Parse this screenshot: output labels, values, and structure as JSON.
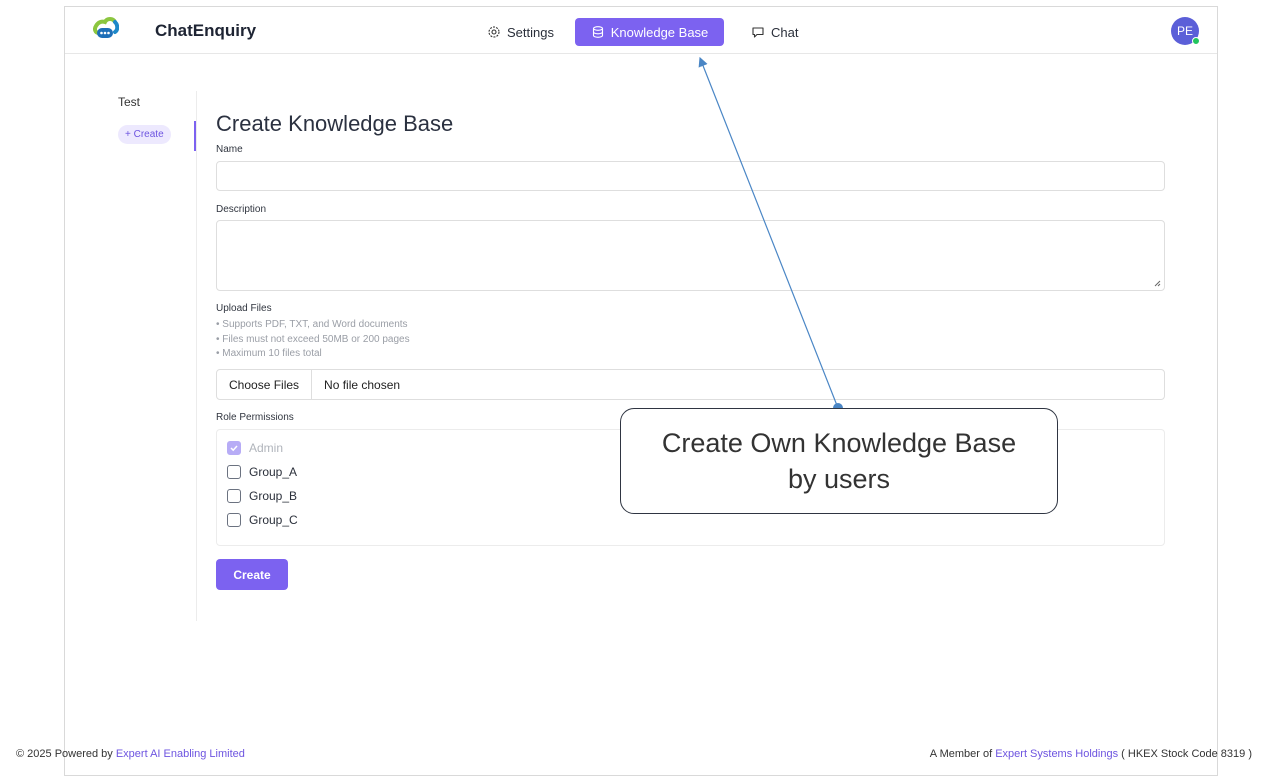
{
  "header": {
    "brand": "ChatEnquiry",
    "nav": [
      {
        "label": "Settings",
        "icon": "gear-icon"
      },
      {
        "label": "Knowledge Base",
        "icon": "database-icon",
        "active": true
      },
      {
        "label": "Chat",
        "icon": "chat-bubble-icon"
      }
    ],
    "avatar": "PE"
  },
  "sidebar": {
    "items": [
      {
        "label": "Test"
      }
    ],
    "create_label": "+ Create"
  },
  "form": {
    "title": "Create Knowledge Base",
    "name_label": "Name",
    "name_value": "",
    "description_label": "Description",
    "description_value": "",
    "upload_label": "Upload Files",
    "upload_hints": [
      "Supports PDF, TXT, and Word documents",
      "Files must not exceed 50MB or 200 pages",
      "Maximum 10 files total"
    ],
    "choose_files_label": "Choose Files",
    "no_file_text": "No file chosen",
    "roles_label": "Role Permissions",
    "roles": [
      {
        "name": "Admin",
        "checked": true,
        "disabled": true
      },
      {
        "name": "Group_A",
        "checked": false
      },
      {
        "name": "Group_B",
        "checked": false
      },
      {
        "name": "Group_C",
        "checked": false
      }
    ],
    "submit_label": "Create"
  },
  "footer": {
    "left_prefix": "© 2025 Powered by",
    "left_link": "Expert AI Enabling Limited",
    "right_prefix": "A Member of",
    "right_link": "Expert Systems Holdings",
    "right_suffix": "( HKEX Stock Code 8319 )"
  },
  "annotation": {
    "text": "Create Own Knowledge Base by users"
  },
  "colors": {
    "accent": "#7c62f0",
    "online": "#22c55e",
    "link": "#6d54e0"
  }
}
